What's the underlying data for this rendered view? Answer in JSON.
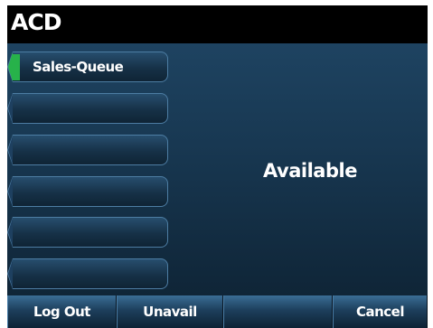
{
  "title": "ACD",
  "line_keys": [
    {
      "label": "Sales-Queue",
      "active": true
    },
    {
      "label": "",
      "active": false
    },
    {
      "label": "",
      "active": false
    },
    {
      "label": "",
      "active": false
    },
    {
      "label": "",
      "active": false
    },
    {
      "label": "",
      "active": false
    }
  ],
  "status": "Available",
  "softkeys": [
    {
      "label": "Log Out"
    },
    {
      "label": "Unavail"
    },
    {
      "label": ""
    },
    {
      "label": "Cancel"
    }
  ],
  "colors": {
    "active_indicator": "#27b24a",
    "background_top": "#1e4361",
    "background_bottom": "#0f2537"
  }
}
